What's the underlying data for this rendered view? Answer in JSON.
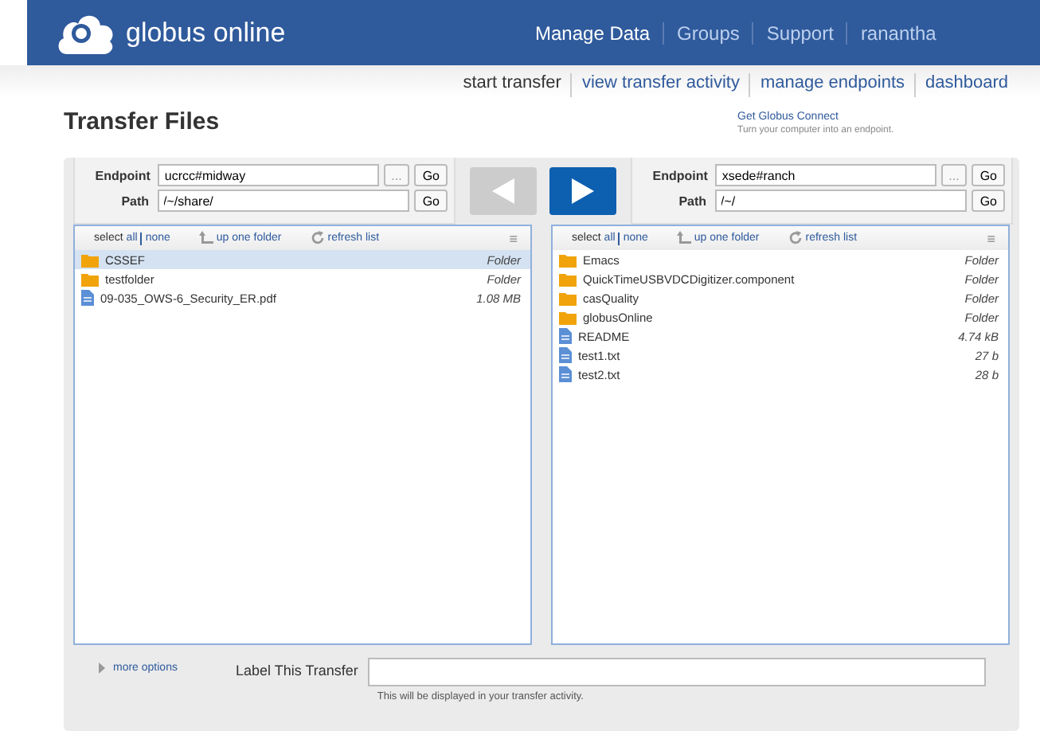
{
  "header": {
    "logo_text": "globus online",
    "nav": [
      {
        "label": "Manage Data",
        "selected": true
      },
      {
        "label": "Groups",
        "selected": false
      },
      {
        "label": "Support",
        "selected": false
      },
      {
        "label": "ranantha",
        "selected": false
      }
    ]
  },
  "subnav": [
    {
      "label": "start transfer",
      "selected": true
    },
    {
      "label": "view transfer activity",
      "selected": false
    },
    {
      "label": "manage endpoints",
      "selected": false
    },
    {
      "label": "dashboard",
      "selected": false
    }
  ],
  "page_title": "Transfer Files",
  "connect": {
    "link": "Get Globus Connect",
    "note": "Turn your computer into an endpoint."
  },
  "arrows": [
    {
      "kind": "left",
      "disabled": true
    },
    {
      "kind": "right",
      "disabled": false
    }
  ],
  "panes": [
    {
      "endpoint_label": "Endpoint",
      "endpoint": "ucrcc#midway",
      "browse": "...",
      "go": "Go",
      "path_label": "Path",
      "path": "/~/share/",
      "path_go": "Go",
      "select": "select",
      "all": "all",
      "none": "none",
      "up": "up one folder",
      "refresh": "refresh list",
      "menu": "≡",
      "files": [
        {
          "name": "CSSEF",
          "kind": "folder",
          "info": "Folder",
          "selected": true
        },
        {
          "name": "testfolder",
          "kind": "folder",
          "info": "Folder",
          "selected": false
        },
        {
          "name": "09-035_OWS-6_Security_ER.pdf",
          "kind": "file",
          "info": "1.08 MB",
          "selected": false
        }
      ]
    },
    {
      "endpoint_label": "Endpoint",
      "endpoint": "xsede#ranch",
      "browse": "...",
      "go": "Go",
      "path_label": "Path",
      "path": "/~/",
      "path_go": "Go",
      "select": "select",
      "all": "all",
      "none": "none",
      "up": "up one folder",
      "refresh": "refresh list",
      "menu": "≡",
      "files": [
        {
          "name": "Emacs",
          "kind": "folder",
          "info": "Folder",
          "selected": false
        },
        {
          "name": "QuickTimeUSBVDCDigitizer.component",
          "kind": "folder",
          "info": "Folder",
          "selected": false
        },
        {
          "name": "casQuality",
          "kind": "folder",
          "info": "Folder",
          "selected": false
        },
        {
          "name": "globusOnline",
          "kind": "folder",
          "info": "Folder",
          "selected": false
        },
        {
          "name": "README",
          "kind": "file",
          "info": "4.74 kB",
          "selected": false
        },
        {
          "name": "test1.txt",
          "kind": "file",
          "info": "27 b",
          "selected": false
        },
        {
          "name": "test2.txt",
          "kind": "file",
          "info": "28 b",
          "selected": false
        }
      ]
    }
  ],
  "more_options": "more options",
  "label_field": {
    "label": "Label This Transfer",
    "hint": "This will be displayed in your transfer activity."
  }
}
